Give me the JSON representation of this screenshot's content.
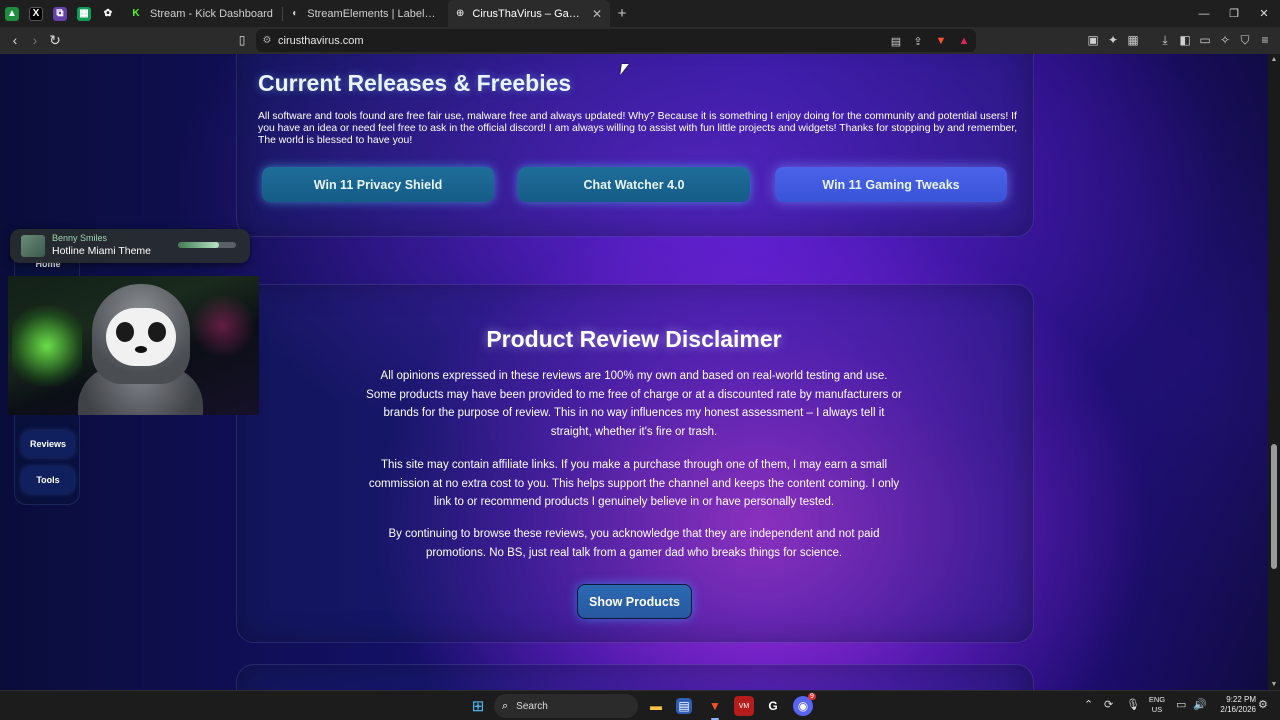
{
  "browser": {
    "pinned_tabs": [
      {
        "name": "drive-pinned-tab",
        "glyph": "▲",
        "color": "#1e8e3e"
      },
      {
        "name": "x-pinned-tab",
        "glyph": "X",
        "color": "#000000"
      },
      {
        "name": "twitch-pinned-tab",
        "glyph": "⧉",
        "color": "#6441a5"
      },
      {
        "name": "sheets-pinned-tab",
        "glyph": "▦",
        "color": "#0f9d58"
      },
      {
        "name": "openai-pinned-tab",
        "glyph": "✿",
        "color": "#202020"
      }
    ],
    "tabs": [
      {
        "title": "Stream - Kick Dashboard",
        "favicon": "kick-icon"
      },
      {
        "title": "StreamElements | Labels and Cambo…",
        "favicon": "streamelements-icon"
      },
      {
        "title": "CirusThaVirus – Gaming | Review…",
        "favicon": "globe-icon",
        "active": true
      }
    ],
    "new_tab_label": "+",
    "url": "cirusthavirus.com"
  },
  "releases": {
    "heading": "Current Releases & Freebies",
    "text": "All software and tools found are free fair use, malware free and always updated! Why? Because it is something I enjoy doing for the community and potential users! If you have an idea or need feel free to ask in the official discord! I am always willing to assist with fun little projects and widgets! Thanks for stopping by and remember, The world is blessed to have you!",
    "buttons": [
      "Win 11 Privacy Shield",
      "Chat Watcher 4.0",
      "Win 11 Gaming Tweaks"
    ]
  },
  "disclaimer": {
    "heading": "Product Review Disclaimer",
    "paragraphs": [
      "All opinions expressed in these reviews are 100% my own and based on real-world testing and use. Some products may have been provided to me free of charge or at a discounted rate by manufacturers or brands for the purpose of review. This in no way influences my honest assessment – I always tell it straight, whether it's fire or trash.",
      "This site may contain affiliate links. If you make a purchase through one of them, I may earn a small commission at no extra cost to you. This helps support the channel and keeps the content coming. I only link to or recommend products I genuinely believe in or have personally tested.",
      "By continuing to browse these reviews, you acknowledge that they are independent and not paid promotions. No BS, just real talk from a gamer dad who breaks things for science."
    ],
    "button": "Show Products"
  },
  "sidenav": {
    "items": [
      "Home",
      "Reviews",
      "Tools"
    ]
  },
  "now_playing": {
    "artist": "Benny Smiles",
    "title": "Hotline Miami Theme",
    "progress": 0.7
  },
  "taskbar": {
    "search_label": "Search",
    "lang_line1": "ENG",
    "lang_line2": "US",
    "time": "9:22 PM",
    "date": "2/16/2026",
    "discord_badge": "9"
  },
  "colors": {
    "accent_teal": "#1f6e9a",
    "accent_blue": "#4a63e8",
    "page_purple": "#2c0fa6"
  }
}
